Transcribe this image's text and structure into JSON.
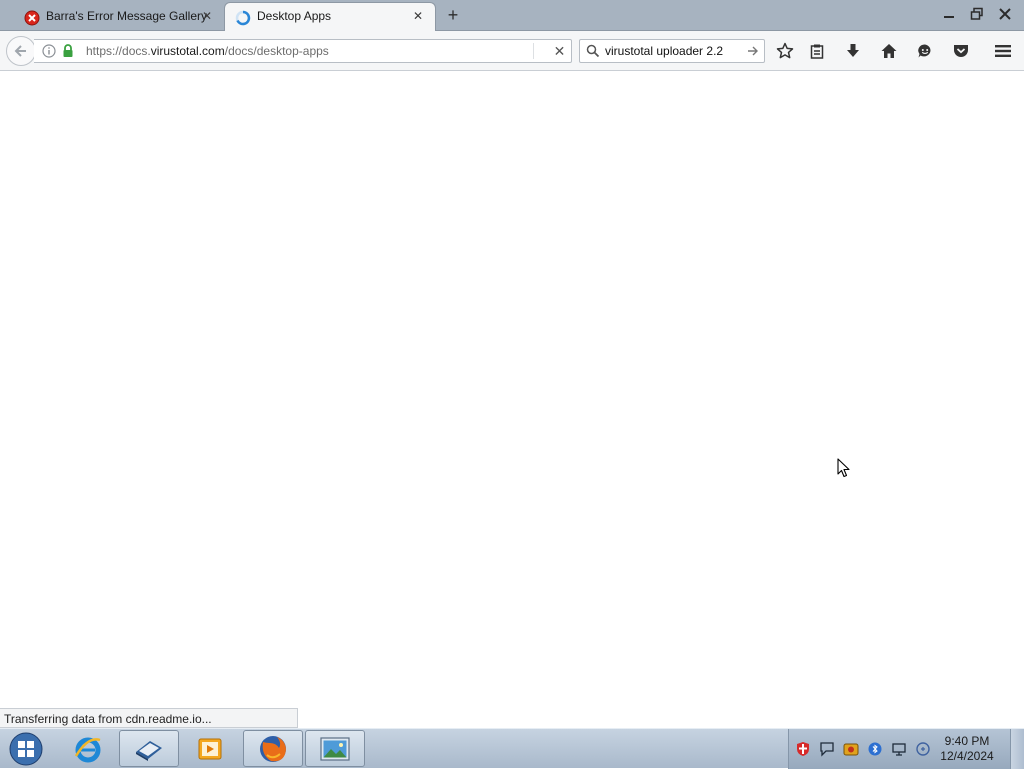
{
  "browser": {
    "tabs": [
      {
        "label": "Barra's Error Message Gallery",
        "icon": "error-icon",
        "active": false
      },
      {
        "label": "Desktop Apps",
        "icon": "loading-spinner-icon",
        "active": true
      }
    ],
    "url": {
      "prefix": "https://docs.",
      "domain": "virustotal.com",
      "path": "/docs/desktop-apps"
    },
    "search": {
      "value": "virustotal uploader 2.2"
    },
    "status": "Transferring data from cdn.readme.io..."
  },
  "taskbar": {
    "clock": {
      "time": "9:40 PM",
      "date": "12/4/2024"
    },
    "items": [
      {
        "name": "internet-explorer",
        "icon": "ie-icon"
      },
      {
        "name": "book-app",
        "icon": "book-icon"
      },
      {
        "name": "media-player",
        "icon": "media-player-icon"
      },
      {
        "name": "firefox",
        "icon": "firefox-icon"
      },
      {
        "name": "image-viewer",
        "icon": "picture-icon"
      }
    ]
  },
  "colors": {
    "tabstrip": "#a7b3c0",
    "toolbar": "#f5f6f7",
    "lock_green": "#3aa140",
    "taskbar": "#b9c8d8"
  }
}
